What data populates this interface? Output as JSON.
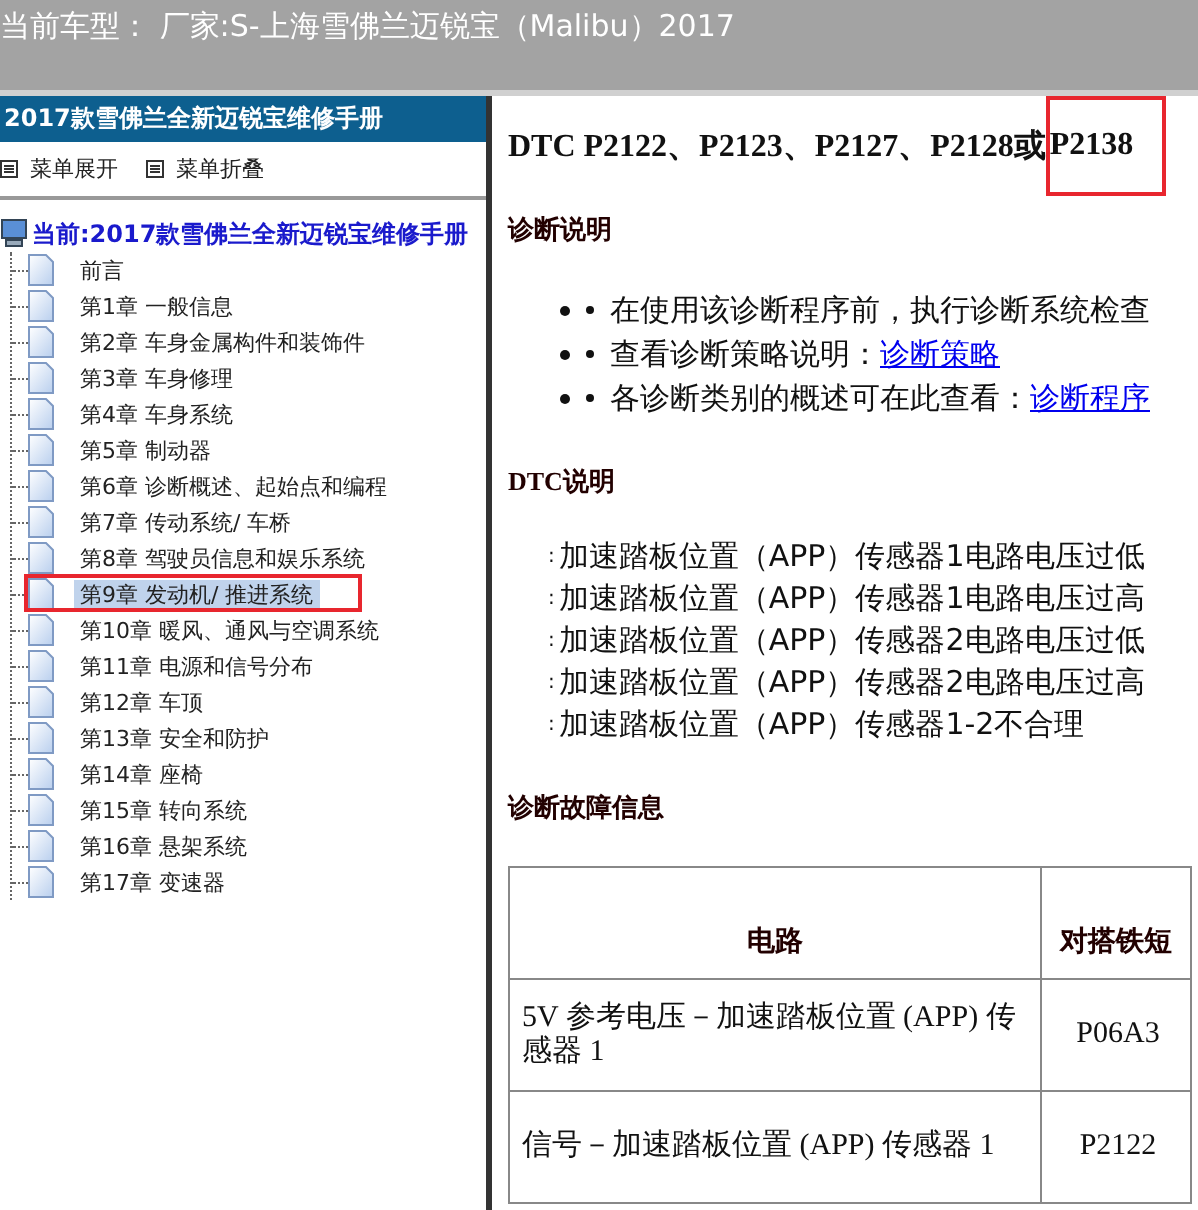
{
  "top_bar": {
    "title": "当前车型： 厂家:S-上海雪佛兰迈锐宝（Malibu）2017"
  },
  "sidebar": {
    "header": "2017款雪佛兰全新迈锐宝维修手册",
    "menu_buttons": [
      "菜单展开",
      "菜单折叠"
    ],
    "tree": {
      "label": "当前:2017款雪佛兰全新迈锐宝维修手册",
      "children": [
        {
          "label": "前言",
          "selected": false,
          "marked": false
        },
        {
          "label": "第1章 一般信息",
          "selected": false,
          "marked": false
        },
        {
          "label": "第2章 车身金属构件和装饰件",
          "selected": false,
          "marked": false
        },
        {
          "label": "第3章 车身修理",
          "selected": false,
          "marked": false
        },
        {
          "label": "第4章 车身系统",
          "selected": false,
          "marked": false
        },
        {
          "label": "第5章 制动器",
          "selected": false,
          "marked": false
        },
        {
          "label": "第6章 诊断概述、起始点和编程",
          "selected": false,
          "marked": false
        },
        {
          "label": "第7章 传动系统/ 车桥",
          "selected": false,
          "marked": false
        },
        {
          "label": "第8章 驾驶员信息和娱乐系统",
          "selected": false,
          "marked": false
        },
        {
          "label": "第9章 发动机/ 推进系统",
          "selected": true,
          "marked": true
        },
        {
          "label": "第10章 暖风、通风与空调系统",
          "selected": false,
          "marked": false
        },
        {
          "label": "第11章 电源和信号分布",
          "selected": false,
          "marked": false
        },
        {
          "label": "第12章 车顶",
          "selected": false,
          "marked": false
        },
        {
          "label": "第13章 安全和防护",
          "selected": false,
          "marked": false
        },
        {
          "label": "第14章 座椅",
          "selected": false,
          "marked": false
        },
        {
          "label": "第15章 转向系统",
          "selected": false,
          "marked": false
        },
        {
          "label": "第16章 悬架系统",
          "selected": false,
          "marked": false
        },
        {
          "label": "第17章 变速器",
          "selected": false,
          "marked": false
        }
      ]
    }
  },
  "content": {
    "heading": {
      "text": "DTC P2122、P2123、P2127、P2128或",
      "marked_part": "P2138"
    },
    "sections": [
      {
        "kind": "bullets",
        "title": "诊断说明",
        "items": [
          {
            "text": "在使用该诊断程序前，执行诊断系统检查"
          },
          {
            "text": "查看诊断策略说明：",
            "link": "诊断策略"
          },
          {
            "text": "各诊断类别的概述可在此查看：",
            "link": "诊断程序"
          }
        ]
      },
      {
        "kind": "dtc",
        "title": "DTC说明",
        "items": [
          {
            "prefix": ":",
            "text": "加速踏板位置（APP）传感器1电路电压过低"
          },
          {
            "prefix": ":",
            "text": "加速踏板位置（APP）传感器1电路电压过高"
          },
          {
            "prefix": ":",
            "text": "加速踏板位置（APP）传感器2电路电压过低"
          },
          {
            "prefix": ":",
            "text": "加速踏板位置（APP）传感器2电路电压过高"
          },
          {
            "prefix": ":",
            "text": "加速踏板位置（APP）传感器1-2不合理"
          }
        ]
      },
      {
        "kind": "table",
        "title": "诊断故障信息",
        "table": {
          "columns": [
            "电路",
            "对搭铁短"
          ],
          "rows": [
            [
              "5V 参考电压－加速踏板位置 (APP) 传感器 1",
              "P06A3"
            ],
            [
              "信号－加速踏板位置 (APP) 传感器 1",
              "P2122"
            ]
          ]
        }
      }
    ]
  }
}
